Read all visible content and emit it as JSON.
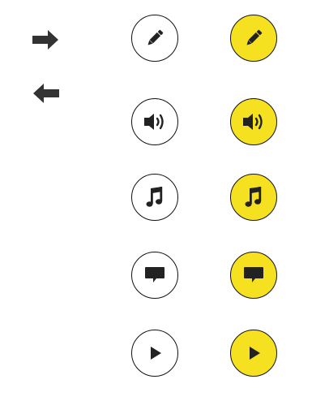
{
  "navigation": {
    "next_icon": "arrow-right-icon",
    "prev_icon": "arrow-left-icon"
  },
  "icon_buttons": [
    {
      "icon": "pencil-icon"
    },
    {
      "icon": "speaker-icon"
    },
    {
      "icon": "music-note-icon"
    },
    {
      "icon": "comment-icon"
    },
    {
      "icon": "play-icon"
    }
  ],
  "states": [
    "normal",
    "highlighted"
  ],
  "colors": {
    "icon": "#222222",
    "outline": "#111111",
    "highlight_fill": "#f5e11f",
    "normal_fill": "#ffffff"
  }
}
